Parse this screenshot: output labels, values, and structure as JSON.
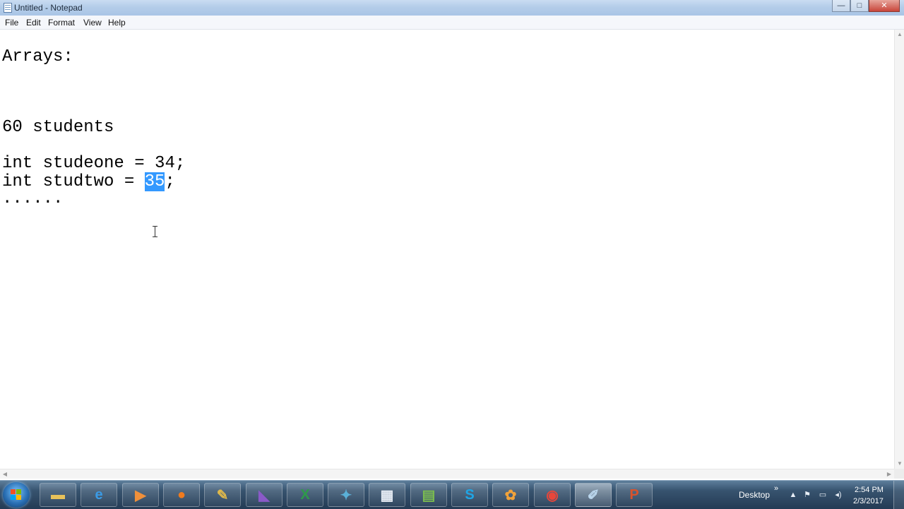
{
  "window": {
    "title": "Untitled - Notepad",
    "controls": {
      "minimize": "—",
      "maximize": "□",
      "close": "✕"
    }
  },
  "menu": {
    "items": [
      "File",
      "Edit",
      "Format",
      "View",
      "Help"
    ]
  },
  "editor": {
    "lines": [
      "Arrays:",
      "",
      "",
      "",
      "60 students",
      "",
      "int studeone = 34;",
      "int studtwo = ",
      "......"
    ],
    "line8_selected": "35",
    "line8_after": ";"
  },
  "taskbar": {
    "items": [
      {
        "name": "explorer",
        "icon": "folder-icon",
        "glyph": "▬",
        "color": "#e8c25a"
      },
      {
        "name": "internet-explorer",
        "icon": "ie-icon",
        "glyph": "e",
        "color": "#3a9be6"
      },
      {
        "name": "media-player",
        "icon": "media-player-icon",
        "glyph": "▶",
        "color": "#f0903a"
      },
      {
        "name": "firefox",
        "icon": "firefox-icon",
        "glyph": "●",
        "color": "#f07b1e"
      },
      {
        "name": "tool",
        "icon": "tool-icon",
        "glyph": "✎",
        "color": "#e0b94a"
      },
      {
        "name": "visual-studio",
        "icon": "visual-studio-icon",
        "glyph": "◣",
        "color": "#8a5ac8"
      },
      {
        "name": "excel",
        "icon": "excel-icon",
        "glyph": "X",
        "color": "#2e9a4a"
      },
      {
        "name": "network-app",
        "icon": "network-icon",
        "glyph": "✦",
        "color": "#5ab0d8"
      },
      {
        "name": "calendar-app",
        "icon": "calendar-icon",
        "glyph": "▦",
        "color": "#e8eef6"
      },
      {
        "name": "files-app",
        "icon": "files-icon",
        "glyph": "▤",
        "color": "#7bbd4f"
      },
      {
        "name": "skype",
        "icon": "skype-icon",
        "glyph": "S",
        "color": "#1fa6e6"
      },
      {
        "name": "flower-app",
        "icon": "flower-icon",
        "glyph": "✿",
        "color": "#f1a23a"
      },
      {
        "name": "chrome",
        "icon": "chrome-icon",
        "glyph": "◉",
        "color": "#e8463a"
      },
      {
        "name": "notepad",
        "icon": "notepad-icon",
        "glyph": "✐",
        "color": "#bcd8ef",
        "active": true
      },
      {
        "name": "powerpoint",
        "icon": "powerpoint-icon",
        "glyph": "P",
        "color": "#d9532c"
      }
    ]
  },
  "tray": {
    "desktop_label": "Desktop",
    "expand_glyph": "»",
    "time": "2:54 PM",
    "date": "2/3/2017"
  }
}
